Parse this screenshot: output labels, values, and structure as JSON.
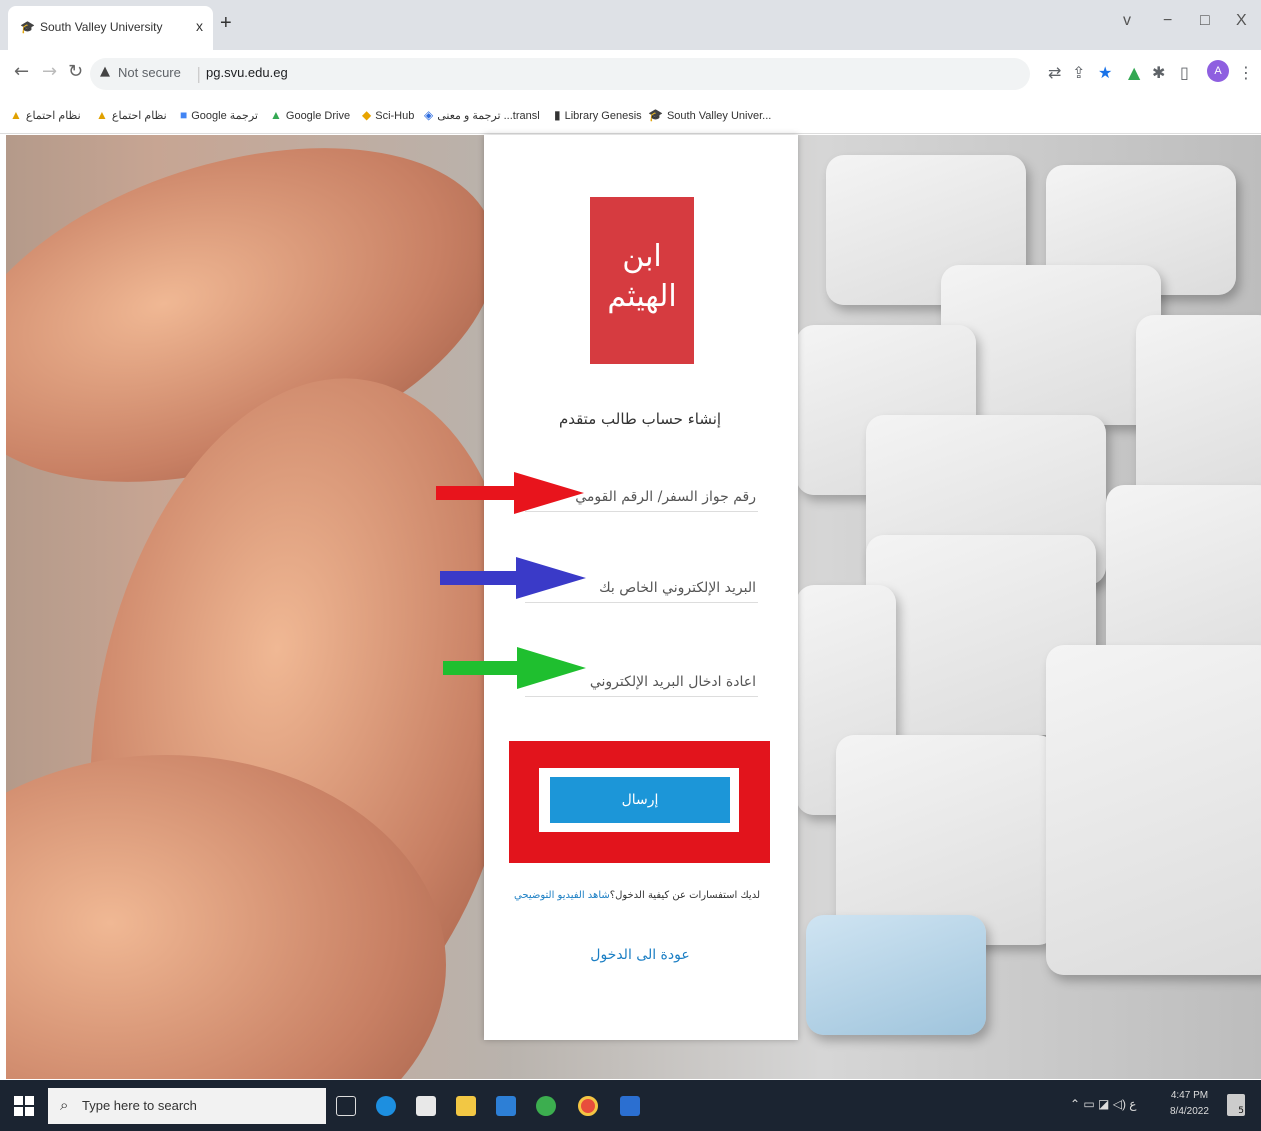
{
  "browser": {
    "tab_title": "South Valley University",
    "tab_close": "x",
    "new_tab": "+",
    "window_controls": [
      "v",
      "−",
      "□",
      "X"
    ],
    "url_security": "Not secure",
    "url": "pg.svu.edu.eg"
  },
  "bookmarks": [
    {
      "label": "نظام احتماع",
      "icon": "drive-icon",
      "color": "#e0a100"
    },
    {
      "label": "نظام احتماع",
      "icon": "drive-icon",
      "color": "#e0a100"
    },
    {
      "label": "Google ترجمة",
      "icon": "translate-icon",
      "color": "#4285f4"
    },
    {
      "label": "Google Drive",
      "icon": "drive-icon",
      "color": "#34a853"
    },
    {
      "label": "Sci-Hub",
      "icon": "scihub-icon",
      "color": "#e8a400"
    },
    {
      "label": "ترجمة و معنى ...transl",
      "icon": "translate-icon",
      "color": "#2d6cdf"
    },
    {
      "label": "Library Genesis",
      "icon": "library-icon",
      "color": "#333333"
    },
    {
      "label": "South Valley Univer...",
      "icon": "svu-icon",
      "color": "#c22222"
    }
  ],
  "form": {
    "logo_line1": "ابن",
    "logo_line2": "الهيثم",
    "title": "إنشاء حساب طالب متقدم",
    "passport_placeholder": "رقم جواز السفر/ الرقم القومي",
    "email_placeholder": "البريد الإلكتروني الخاص بك",
    "email_confirm_placeholder": "اعادة ادخال البريد الإلكتروني",
    "submit_label": "إرسال",
    "help_text": "لديك استفسارات عن كيفية الدخول؟",
    "help_link": "شاهد الفيديو التوضيحي",
    "back_link": "عودة الى الدخول"
  },
  "annotations": {
    "arrow_colors": [
      "#e8141c",
      "#3a3ac8",
      "#1fbf2f"
    ],
    "highlight_color": "#e2141c"
  },
  "colors": {
    "logo_bg": "#d63b40",
    "submit_bg": "#1c96d8",
    "link": "#1c7fc4"
  },
  "taskbar": {
    "search_placeholder": "Type here to search",
    "clock_time": "4:47 PM",
    "clock_date": "8/4/2022",
    "notification_count": "5"
  }
}
